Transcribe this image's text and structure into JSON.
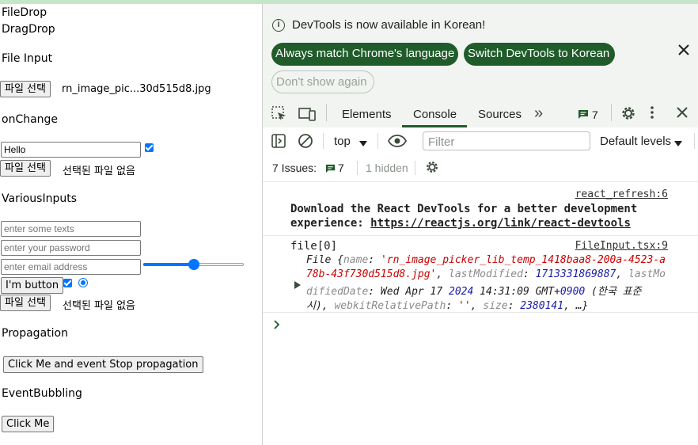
{
  "page": {
    "filedrop": "FileDrop",
    "dragdrop": "DragDrop",
    "file_input_heading": "File Input",
    "file_button_label": "파일 선택",
    "chosen_file_name": "rn_image_pic...30d515d8.jpg",
    "onchange_heading": "onChange",
    "hello_value": "Hello",
    "no_file_chosen": "선택된 파일 없음",
    "various_heading": "VariousInputs",
    "text_placeholder": "enter some texts",
    "password_placeholder": "enter your password",
    "email_placeholder": "enter email address",
    "slider_value_percent": 50,
    "im_button": "I'm button",
    "propagation_heading": "Propagation",
    "propagation_button": "Click Me and event Stop propagation",
    "bubbling_heading": "EventBubbling",
    "click_me": "Click Me"
  },
  "devtools": {
    "notice_text": "DevTools is now available in Korean!",
    "btn_always_match": "Always match Chrome's language",
    "btn_switch": "Switch DevTools to Korean",
    "btn_dont_show": "Don't show again",
    "tabs": [
      "Elements",
      "Console",
      "Sources"
    ],
    "active_tab": "Console",
    "message_count": "7",
    "context": "top",
    "filter_placeholder": "Filter",
    "levels": "Default levels",
    "issues_label": "7 Issues:",
    "issues_count": "7",
    "hidden_label": "1 hidden",
    "log1_source": "react_refresh:6",
    "log1_line1": "Download the React DevTools for a better development",
    "log1_line2_prefix": "experience: ",
    "log1_link": "https://reactjs.org/link/react-devtools",
    "log2_label": "file[0]",
    "log2_source": "FileInput.tsx:9",
    "log2_obj_line1": "File {name: 'rn_image_picker_lib_temp_1418baa8-200a-4523-a",
    "log2_obj_line2": "78b-43f730d515d8.jpg', lastModified: 1713331869887, lastMo",
    "log2_obj_line3": "difiedDate: Wed Apr 17 2024 14:31:09 GMT+0900 (한국 표준",
    "log2_obj_line4": "시), webkitRelativePath: '', size: 2380141, …}",
    "colors": {
      "accent_green": "#1f5c2a",
      "bg_panel": "#f1f4f1",
      "string_red": "#c80000"
    }
  }
}
